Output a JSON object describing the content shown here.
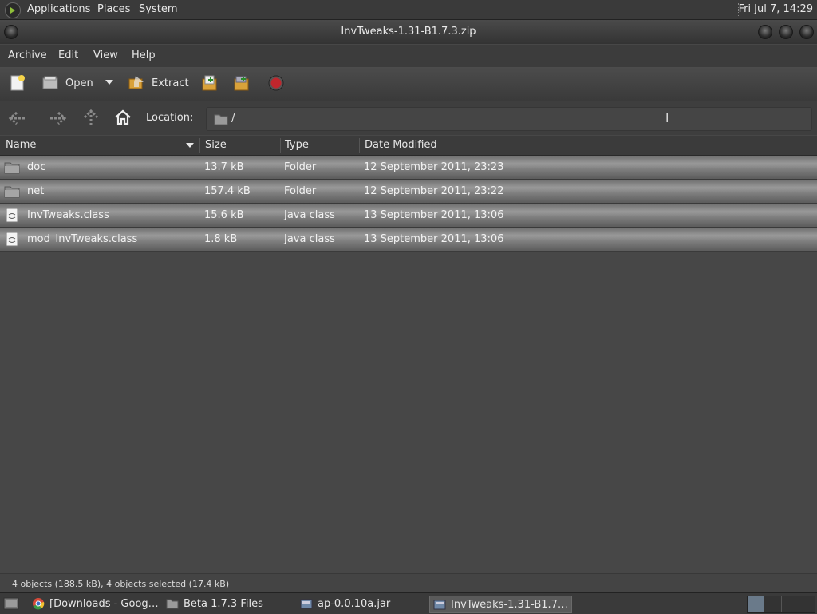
{
  "top_panel": {
    "menus": [
      "Applications",
      "Places",
      "System"
    ],
    "clock": "Fri Jul  7, 14:29"
  },
  "window": {
    "title": "InvTweaks-1.31-B1.7.3.zip"
  },
  "menubar": [
    "Archive",
    "Edit",
    "View",
    "Help"
  ],
  "toolbar": {
    "open_label": "Open",
    "extract_label": "Extract"
  },
  "location": {
    "label": "Location:",
    "path": "/"
  },
  "columns": [
    "Name",
    "Size",
    "Type",
    "Date Modified"
  ],
  "files": [
    {
      "name": "doc",
      "size": "13.7 kB",
      "type": "Folder",
      "modified": "12 September 2011, 23:23",
      "icon": "folder-icon"
    },
    {
      "name": "net",
      "size": "157.4 kB",
      "type": "Folder",
      "modified": "12 September 2011, 23:22",
      "icon": "folder-icon"
    },
    {
      "name": "InvTweaks.class",
      "size": "15.6 kB",
      "type": "Java class",
      "modified": "13 September 2011, 13:06",
      "icon": "java-file-icon"
    },
    {
      "name": "mod_InvTweaks.class",
      "size": "1.8 kB",
      "type": "Java class",
      "modified": "13 September 2011, 13:06",
      "icon": "java-file-icon"
    }
  ],
  "status": "4 objects (188.5 kB), 4 objects selected (17.4 kB)",
  "taskbar": [
    {
      "label": "[Downloads - Goog…",
      "icon": "chrome-icon"
    },
    {
      "label": "Beta 1.7.3 Files",
      "icon": "folder-icon"
    },
    {
      "label": "ap-0.0.10a.jar",
      "icon": "archive-icon"
    },
    {
      "label": "InvTweaks-1.31-B1.7…",
      "icon": "archive-icon"
    }
  ],
  "colors": {
    "selection_row": "#8a8a8a",
    "background": "#474747",
    "record_button": "#c0262d"
  }
}
